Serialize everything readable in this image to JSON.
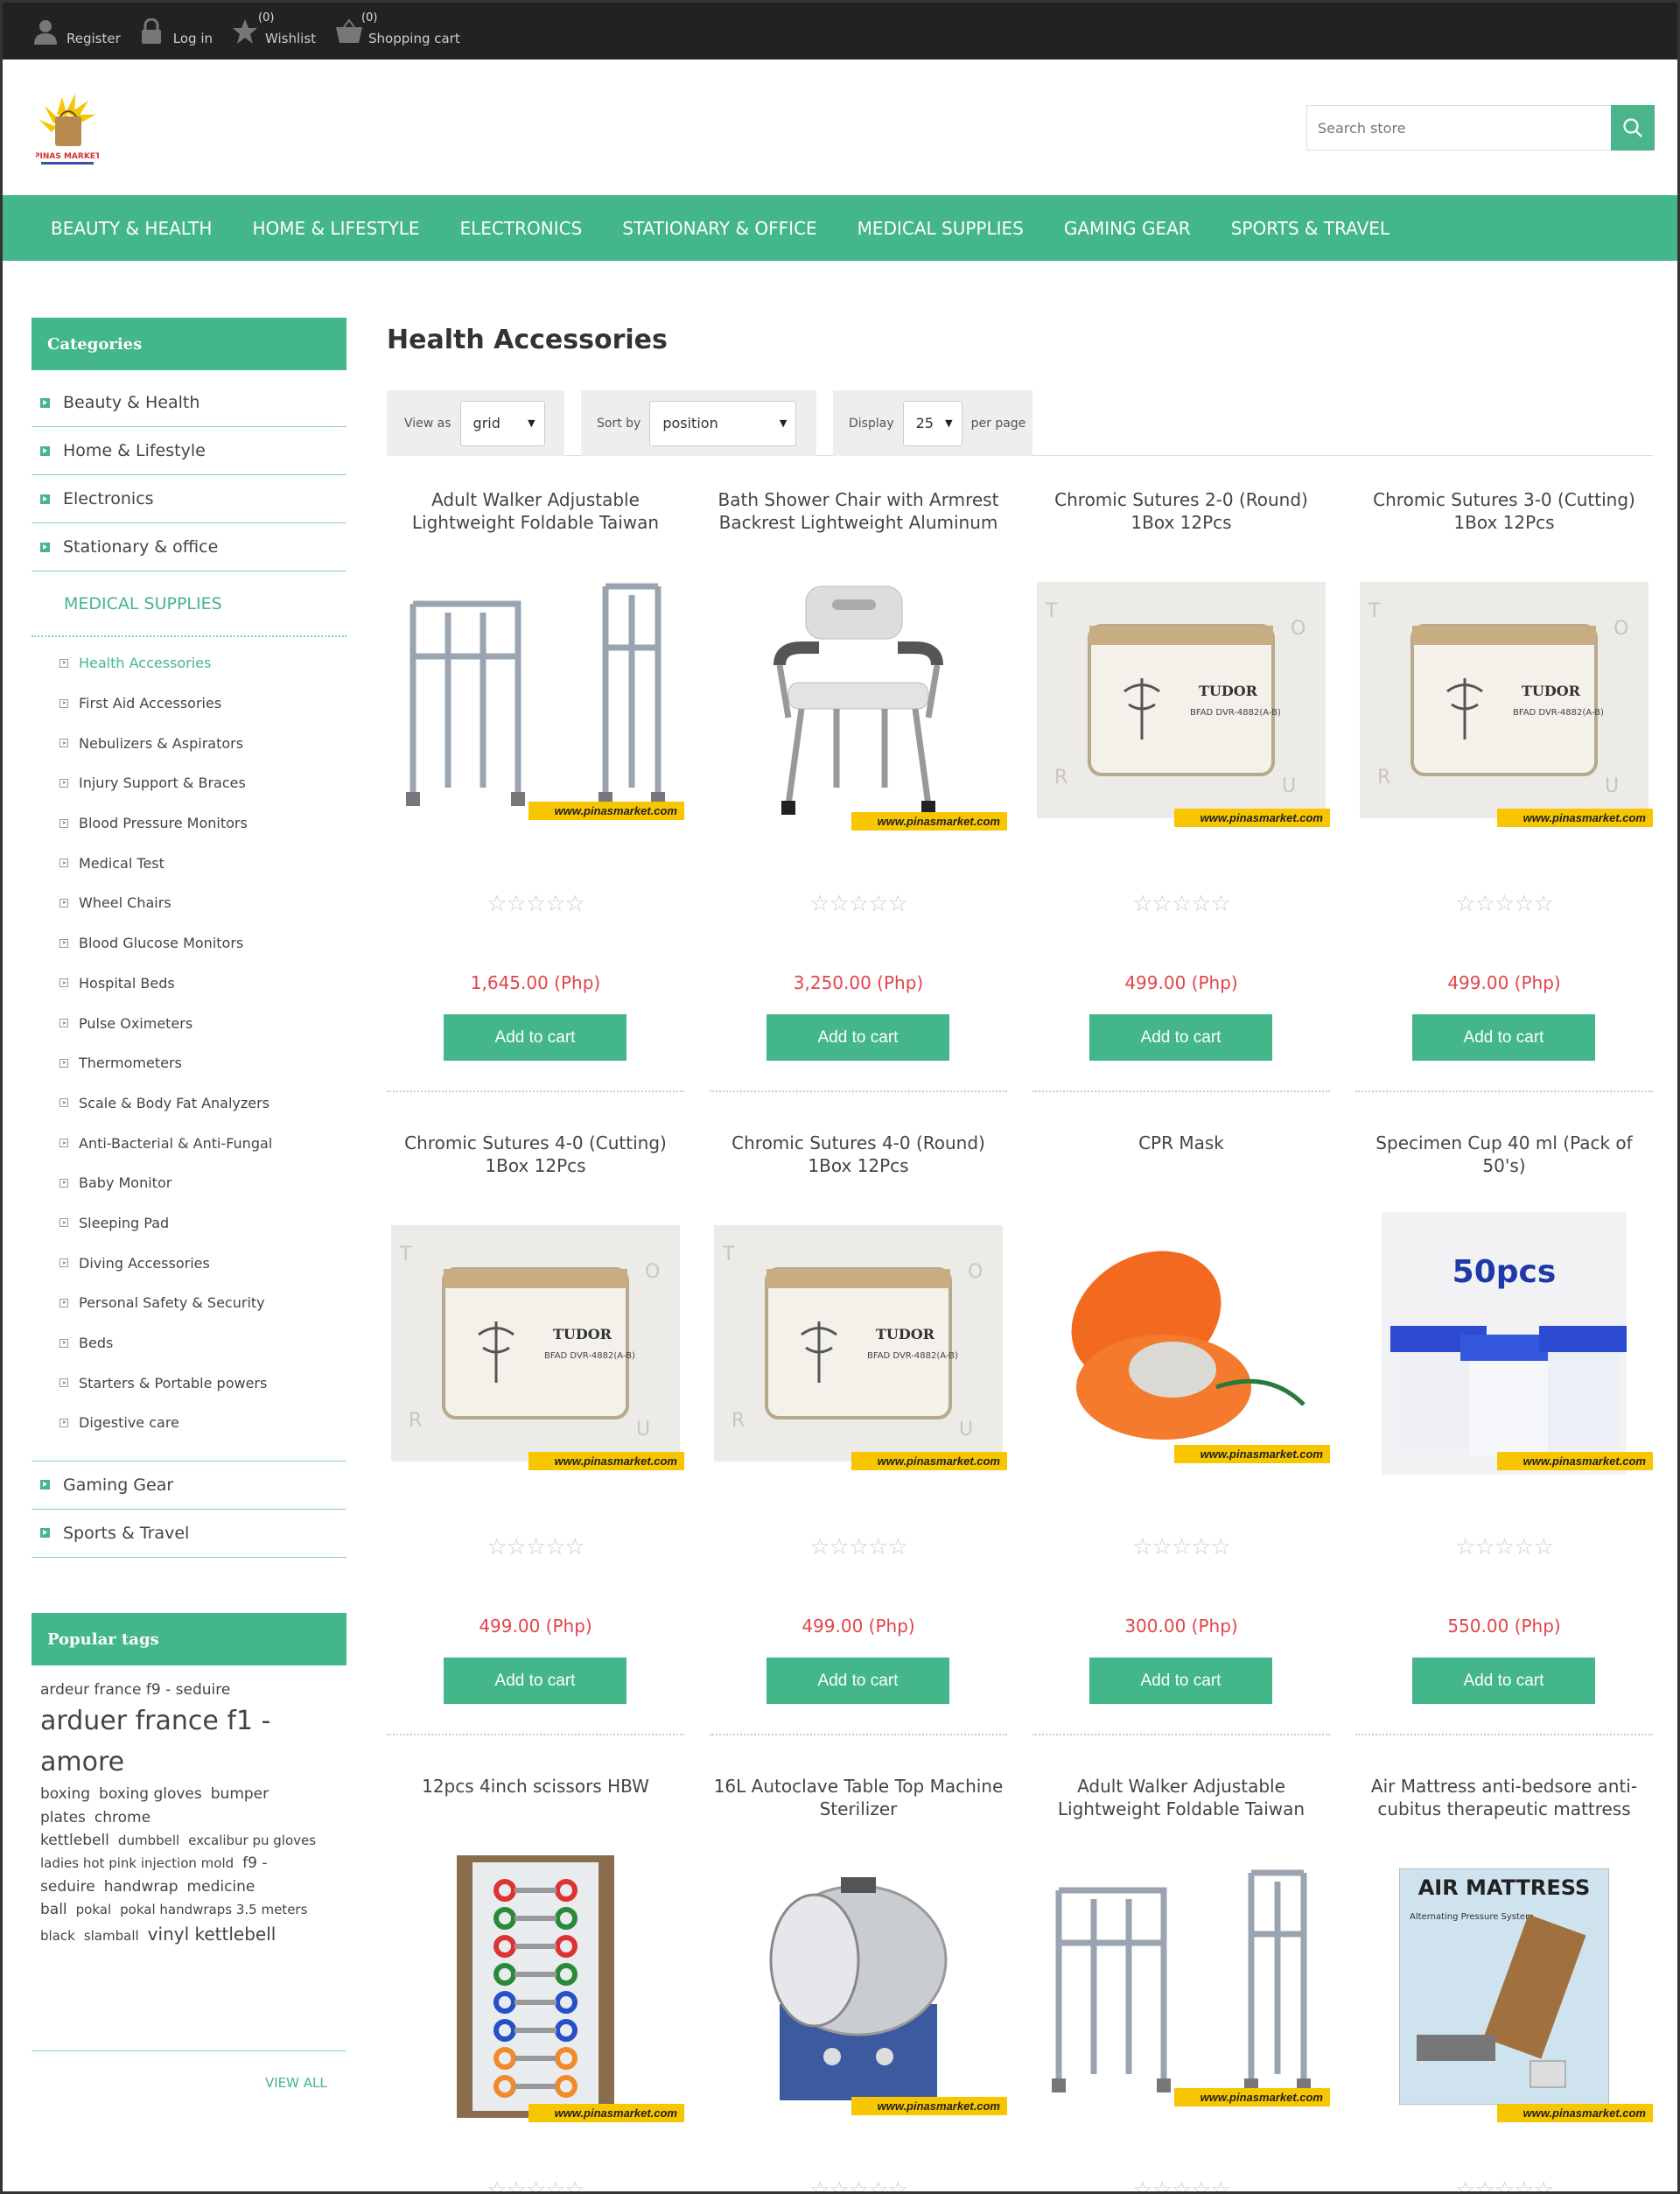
{
  "header": {
    "links": [
      {
        "label": "Register",
        "icon": "user-icon"
      },
      {
        "label": "Log in",
        "icon": "lock-icon"
      },
      {
        "label": "Wishlist",
        "icon": "star-icon",
        "count": "(0)"
      },
      {
        "label": "Shopping cart",
        "icon": "cart-icon",
        "count": "(0)"
      }
    ],
    "logo_text": "PINAS MARKET",
    "search_placeholder": "Search store"
  },
  "nav": [
    "BEAUTY & HEALTH",
    "HOME & LIFESTYLE",
    "ELECTRONICS",
    "STATIONARY & OFFICE",
    "MEDICAL SUPPLIES",
    "GAMING GEAR",
    "SPORTS & TRAVEL"
  ],
  "sidebar": {
    "categories_title": "Categories",
    "top_categories": [
      "Beauty & Health",
      "Home & Lifestyle",
      "Electronics",
      "Stationary & office"
    ],
    "current_category": "MEDICAL SUPPLIES",
    "subcategories": [
      "Health Accessories",
      "First Aid Accessories",
      "Nebulizers & Aspirators",
      "Injury Support & Braces",
      "Blood Pressure Monitors",
      "Medical Test",
      "Wheel Chairs",
      "Blood Glucose Monitors",
      "Hospital Beds",
      "Pulse Oximeters",
      "Thermometers",
      "Scale & Body Fat Analyzers",
      "Anti-Bacterial & Anti-Fungal",
      "Baby Monitor",
      "Sleeping Pad",
      "Diving Accessories",
      "Personal Safety & Security",
      "Beds",
      "Starters & Portable powers",
      "Digestive care"
    ],
    "active_subcategory": "Health Accessories",
    "bottom_categories": [
      "Gaming Gear",
      "Sports & Travel"
    ],
    "tags_title": "Popular tags",
    "tags": [
      {
        "text": "ardeur france f9 - seduire",
        "size": "m"
      },
      {
        "text": "arduer france f1 - amore",
        "size": "xl"
      },
      {
        "text": "boxing",
        "size": "m"
      },
      {
        "text": "boxing gloves",
        "size": "m"
      },
      {
        "text": "bumper plates",
        "size": "m"
      },
      {
        "text": "chrome kettlebell",
        "size": "m"
      },
      {
        "text": "dumbbell",
        "size": "s"
      },
      {
        "text": "excalibur pu gloves ladies hot pink injection mold",
        "size": "s"
      },
      {
        "text": "f9 - seduire",
        "size": "m"
      },
      {
        "text": "handwrap",
        "size": "m"
      },
      {
        "text": "medicine ball",
        "size": "m"
      },
      {
        "text": "pokal",
        "size": "s"
      },
      {
        "text": "pokal handwraps 3.5 meters black",
        "size": "s"
      },
      {
        "text": "slamball",
        "size": "s"
      },
      {
        "text": "vinyl kettlebell",
        "size": "l"
      }
    ],
    "view_all": "VIEW ALL"
  },
  "main": {
    "title": "Health Accessories",
    "view_as_label": "View as",
    "view_as_value": "grid",
    "sort_by_label": "Sort by",
    "sort_by_value": "position",
    "display_label": "Display",
    "display_value": "25",
    "per_page_label": "per page",
    "add_to_cart": "Add to cart",
    "watermark": "www.pinasmarket.com",
    "products": [
      {
        "name": "Adult Walker Adjustable Lightweight Foldable Taiwan",
        "price": "1,645.00 (Php)",
        "img": "walker"
      },
      {
        "name": "Bath Shower Chair with Armrest Backrest Lightweight Aluminum",
        "price": "3,250.00 (Php)",
        "img": "chair"
      },
      {
        "name": "Chromic Sutures 2-0 (Round) 1Box 12Pcs",
        "price": "499.00 (Php)",
        "img": "suture"
      },
      {
        "name": "Chromic Sutures 3-0 (Cutting) 1Box 12Pcs",
        "price": "499.00 (Php)",
        "img": "suture"
      },
      {
        "name": "Chromic Sutures 4-0 (Cutting) 1Box 12Pcs",
        "price": "499.00 (Php)",
        "img": "suture"
      },
      {
        "name": "Chromic Sutures 4-0 (Round) 1Box 12Pcs",
        "price": "499.00 (Php)",
        "img": "suture"
      },
      {
        "name": "CPR Mask",
        "price": "300.00 (Php)",
        "img": "cpr"
      },
      {
        "name": "Specimen Cup 40 ml (Pack of 50's)",
        "price": "550.00 (Php)",
        "img": "cup"
      },
      {
        "name": "12pcs 4inch scissors HBW",
        "price": "",
        "img": "scissors"
      },
      {
        "name": "16L Autoclave Table Top Machine Sterilizer",
        "price": "",
        "img": "autoclave"
      },
      {
        "name": "Adult Walker Adjustable Lightweight Foldable Taiwan",
        "price": "",
        "img": "walker"
      },
      {
        "name": "Air Mattress anti-bedsore anti-cubitus therapeutic mattress",
        "price": "",
        "img": "mattress"
      }
    ],
    "suture_brand": "TUDOR",
    "suture_code": "BFAD DVR-4882(A-B)",
    "cup_label": "50pcs",
    "mattress_label": "AIR MATTRESS",
    "mattress_sub": "Alternating Pressure System"
  },
  "colors": {
    "accent": "#43b68a",
    "price": "#e4434b",
    "topbar": "#222222",
    "watermark": "#f7c600"
  }
}
